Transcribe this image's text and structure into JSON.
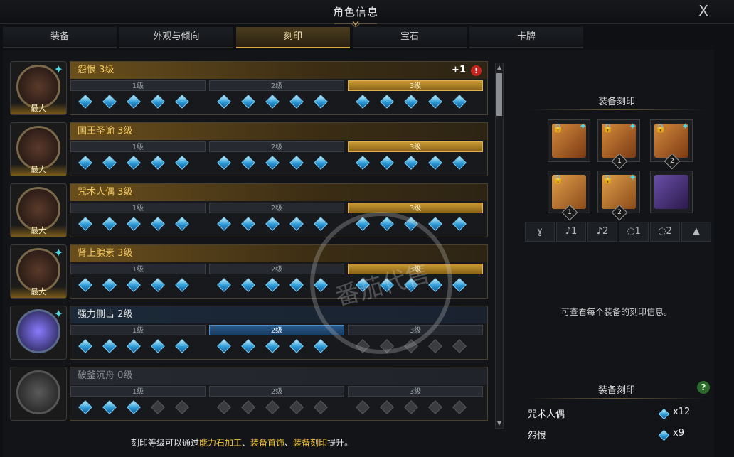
{
  "window": {
    "title": "角色信息",
    "close_label": "X"
  },
  "tabs": [
    {
      "label": "装备"
    },
    {
      "label": "外观与倾向"
    },
    {
      "label": "刻印",
      "active": true
    },
    {
      "label": "宝石"
    },
    {
      "label": "卡牌"
    }
  ],
  "engravings": [
    {
      "name": "怨恨 3级",
      "max": "最大",
      "style": "gold",
      "active_tier": 3,
      "gems_on": 15,
      "plus": "+1",
      "alert": "!",
      "star": true
    },
    {
      "name": "国王圣谕 3级",
      "max": "最大",
      "style": "gold",
      "active_tier": 3,
      "gems_on": 15,
      "star": false
    },
    {
      "name": "咒术人偶 3级",
      "max": "最大",
      "style": "gold",
      "active_tier": 3,
      "gems_on": 15,
      "star": false
    },
    {
      "name": "肾上腺素 3级",
      "max": "最大",
      "style": "gold",
      "active_tier": 3,
      "gems_on": 15,
      "star": true
    },
    {
      "name": "强力侧击 2级",
      "max": "",
      "style": "blue",
      "active_tier": 2,
      "gems_on": 10,
      "star": true
    },
    {
      "name": "破釜沉舟 0级",
      "max": "",
      "style": "gray",
      "active_tier": 0,
      "gems_on": 3,
      "star": false
    }
  ],
  "tier_labels": [
    "1级",
    "2级",
    "3级"
  ],
  "hint": {
    "prefix": "刻印等级可以通过",
    "hl1": "能力石加工",
    "sep1": "、",
    "hl2": "装备首饰",
    "sep2": "、",
    "hl3": "装备刻印",
    "suffix": "提升。"
  },
  "right_panel": {
    "equip_title": "装备刻印",
    "slots": [
      {
        "kind": "necklace",
        "num": "",
        "star": true
      },
      {
        "kind": "earring",
        "num": "1",
        "star": true
      },
      {
        "kind": "earring",
        "num": "2",
        "star": true
      },
      {
        "kind": "ring",
        "num": "1",
        "star": false
      },
      {
        "kind": "ring",
        "num": "2",
        "star": true
      },
      {
        "kind": "stone",
        "num": "",
        "star": false
      }
    ],
    "filters": [
      "necklace-filter",
      "earring1-filter",
      "earring2-filter",
      "ring1-filter",
      "ring2-filter",
      "stone-filter"
    ],
    "filter_glyphs": [
      "ɣ",
      "♪1",
      "♪2",
      "◌1",
      "◌2",
      "▲"
    ],
    "info_text": "可查看每个装备的刻印信息。",
    "summary_title": "装备刻印",
    "help_label": "?",
    "summary": [
      {
        "name": "咒术人偶",
        "count": "x12"
      },
      {
        "name": "怨恨",
        "count": "x9"
      }
    ]
  },
  "watermark": "番茄代售"
}
